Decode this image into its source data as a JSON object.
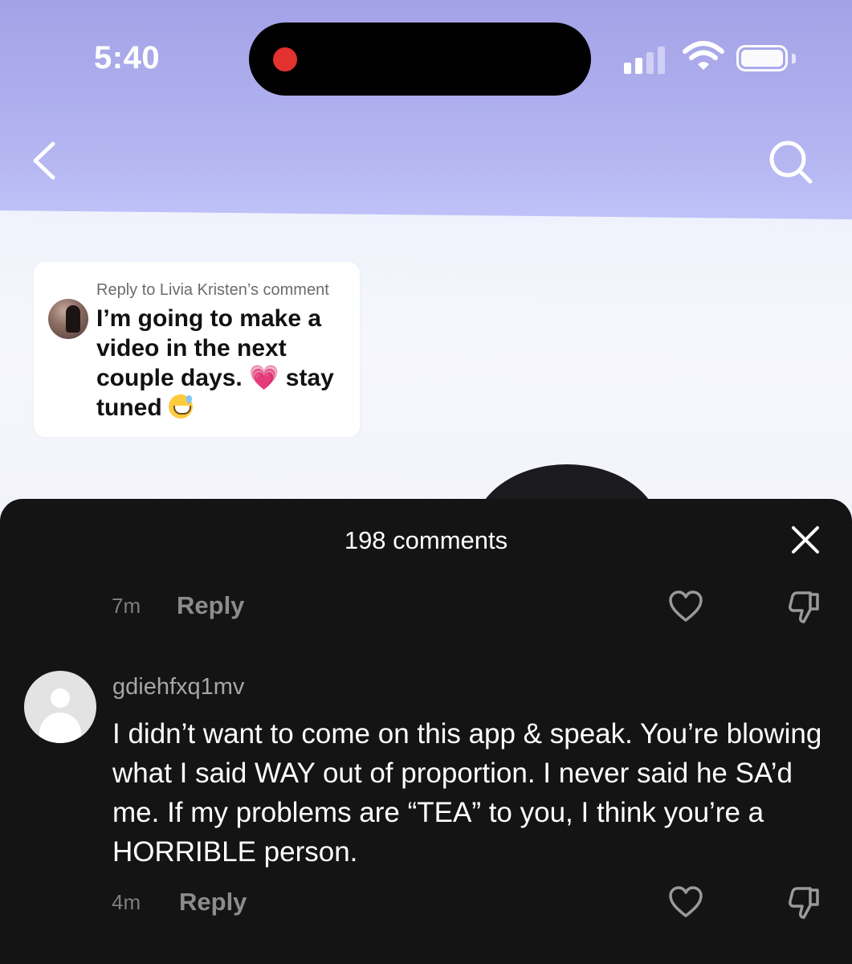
{
  "status_bar": {
    "time": "5:40",
    "signal_bars_active": 2,
    "signal_bars_total": 4
  },
  "nav": {
    "back_icon": "chevron-left-icon",
    "search_icon": "search-icon"
  },
  "reply_sticker": {
    "reply_to": "Reply to Livia Kristen’s comment",
    "text_part1": "I’m going to make a video in the next couple days.",
    "heart_emoji": "💗",
    "text_part2": "stay tuned"
  },
  "comments_sheet": {
    "title": "198 comments",
    "close_icon": "close-icon",
    "previous_comment": {
      "time": "7m",
      "reply_label": "Reply"
    },
    "comment": {
      "username": "gdiehfxq1mv",
      "text": "I didn’t want to come on this app & speak. You’re blowing what I said WAY out of proportion. I never said he SA’d me. If my problems are “TEA” to you, I think you’re a HORRIBLE person.",
      "time": "4m",
      "reply_label": "Reply"
    }
  },
  "colors": {
    "sheet_bg": "#141414",
    "sky_top": "#a3a2e7",
    "heart_emoji": "#ff2d95",
    "recording_dot": "#e3312f"
  }
}
